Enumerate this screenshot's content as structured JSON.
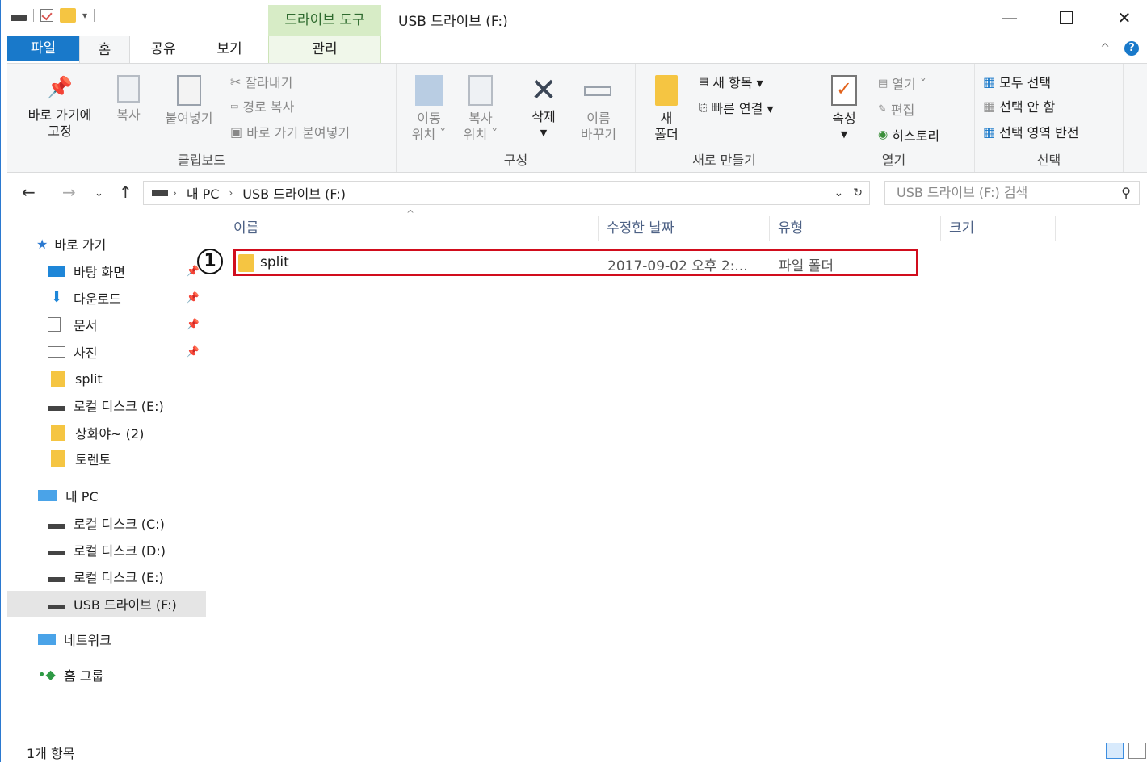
{
  "titlebar": {
    "context_tab": "드라이브 도구",
    "title": "USB 드라이브 (F:)"
  },
  "tabs": {
    "file": "파일",
    "home": "홈",
    "share": "공유",
    "view": "보기",
    "manage": "관리"
  },
  "ribbon": {
    "clipboard": {
      "label": "클립보드",
      "pin_quick_line1": "바로 가기에",
      "pin_quick_line2": "고정",
      "copy": "복사",
      "paste": "붙여넣기",
      "cut": "잘라내기",
      "copy_path": "경로 복사",
      "paste_shortcut": "바로 가기 붙여넣기"
    },
    "organize": {
      "label": "구성",
      "move_line1": "이동",
      "move_line2": "위치 ˇ",
      "copy_line1": "복사",
      "copy_line2": "위치 ˇ",
      "delete": "삭제",
      "rename_line1": "이름",
      "rename_line2": "바꾸기"
    },
    "new": {
      "label": "새로 만들기",
      "new_folder_line1": "새",
      "new_folder_line2": "폴더",
      "new_item": "새 항목 ▾",
      "easy_access": "빠른 연결 ▾"
    },
    "open": {
      "label": "열기",
      "properties": "속성",
      "open": "열기 ˇ",
      "edit": "편집",
      "history": "히스토리"
    },
    "select": {
      "label": "선택",
      "select_all": "모두 선택",
      "select_none": "선택 안 함",
      "invert": "선택 영역 반전"
    }
  },
  "address": {
    "pc": "내 PC",
    "drive": "USB 드라이브 (F:)",
    "search_placeholder": "USB 드라이브 (F:) 검색"
  },
  "sidebar": {
    "quick_access": "바로 가기",
    "desktop": "바탕 화면",
    "downloads": "다운로드",
    "documents": "문서",
    "pictures": "사진",
    "split": "split",
    "local_e_quick": "로컬 디스크 (E:)",
    "sanghwa": "상화야~ (2)",
    "torrent": "토렌토",
    "my_pc": "내 PC",
    "local_c": "로컬 디스크 (C:)",
    "local_d": "로컬 디스크 (D:)",
    "local_e": "로컬 디스크 (E:)",
    "usb_f": "USB 드라이브 (F:)",
    "network": "네트워크",
    "homegroup": "홈 그룹"
  },
  "columns": {
    "name": "이름",
    "modified": "수정한 날짜",
    "type": "유형",
    "size": "크기"
  },
  "files": [
    {
      "name": "split",
      "modified": "2017-09-02 오후 2:...",
      "type": "파일 폴더",
      "size": ""
    }
  ],
  "annotation": "1",
  "status": {
    "count": "1개 항목"
  },
  "colors": {
    "file_tab": "#1979ca",
    "manage_tab": "#d7ecc6",
    "highlight_box": "#d10d1d",
    "folder": "#f5c542"
  }
}
